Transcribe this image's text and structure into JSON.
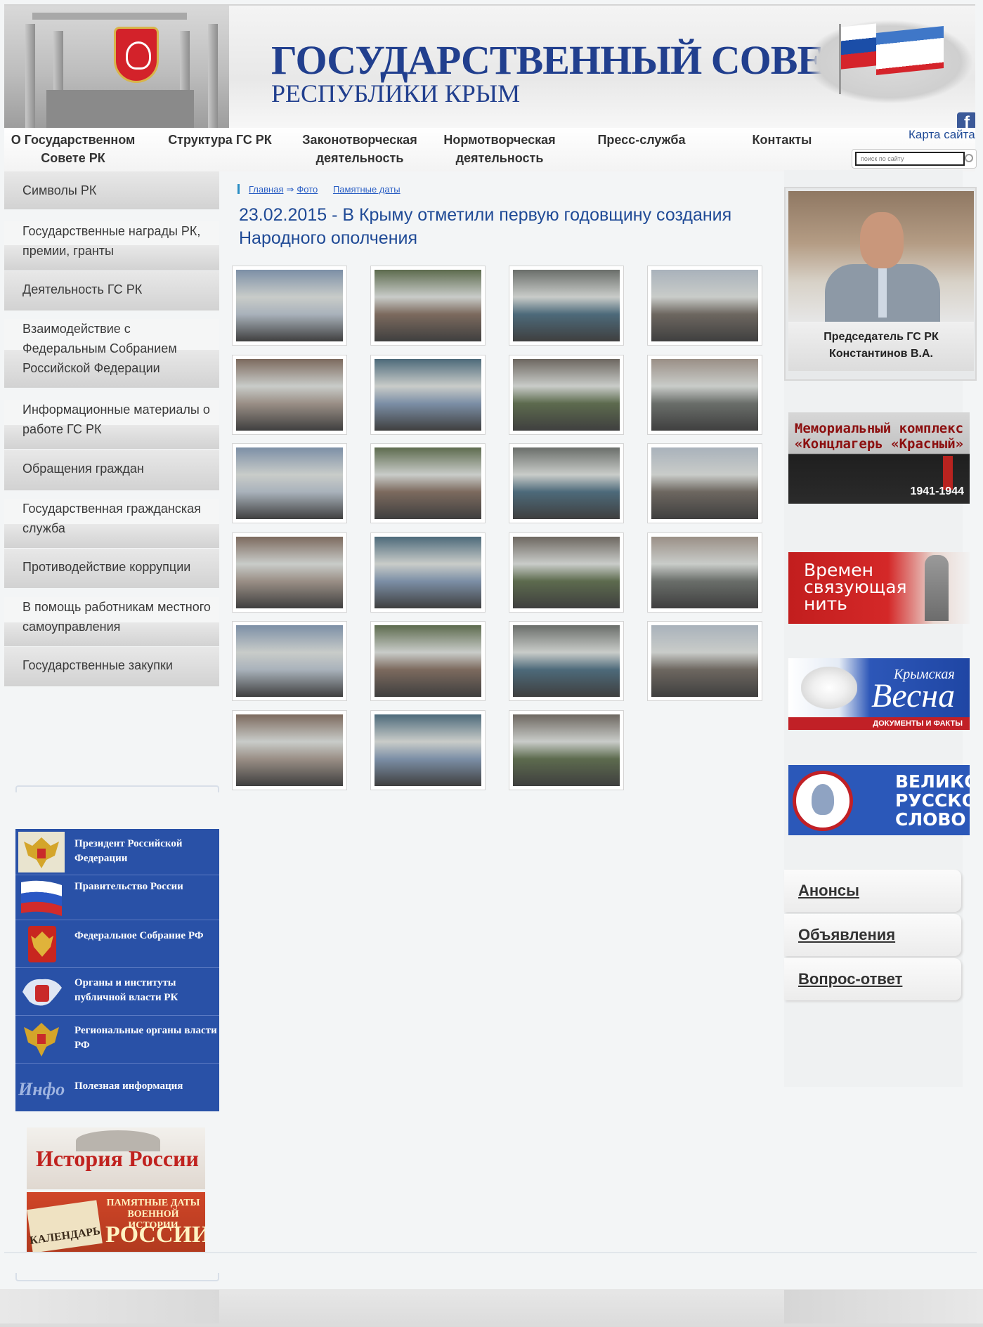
{
  "header": {
    "title_line1": "ГОСУДАРСТВЕННЫЙ СОВЕТ",
    "title_line2": "РЕСПУБЛИКИ КРЫМ",
    "facebook_icon": "facebook-icon"
  },
  "nav": {
    "items": [
      {
        "line1": "О Государственном",
        "line2": "Совете РК"
      },
      {
        "line1": "Структура ГС РК",
        "line2": ""
      },
      {
        "line1": "Законотворческая",
        "line2": "деятельность"
      },
      {
        "line1": "Нормотворческая",
        "line2": "деятельность"
      },
      {
        "line1": "Пресс-служба",
        "line2": ""
      },
      {
        "line1": "Контакты",
        "line2": ""
      }
    ],
    "sitemap_label": "Карта сайта",
    "search_placeholder": "поиск по сайту"
  },
  "left_menu": {
    "items": [
      "Символы РК",
      "Государственные награды РК, премии, гранты",
      "Деятельность ГС РК",
      "Взаимодействие с Федеральным Собранием Российской Федерации",
      "Информационные материалы о работе ГС РК",
      "Обращения граждан",
      "Государственная гражданская служба",
      "Противодействие коррупции",
      "В помощь работникам местного самоуправления",
      "Государственные закупки"
    ]
  },
  "links": {
    "items": [
      {
        "label": "Президент Российской Федерации",
        "icon": "russian-eagle-icon"
      },
      {
        "label": "Правительство России",
        "icon": "russian-flag-icon"
      },
      {
        "label": "Федеральное Собрание РФ",
        "icon": "federal-emblem-icon"
      },
      {
        "label": "Органы и институты публичной власти РК",
        "icon": "crimea-map-icon"
      },
      {
        "label": "Региональные органы власти РФ",
        "icon": "regional-eagle-icon"
      },
      {
        "label": "Полезная информация",
        "icon": "info-icon"
      }
    ],
    "info_icon_text": "Инфо"
  },
  "left_banners": {
    "history": "История России",
    "calendar_line1": "ПАМЯТНЫЕ ДАТЫ ВОЕННОЙ ИСТОРИИ",
    "calendar_line2": "РОССИИ",
    "calendar_tag": "КАЛЕНДАРЬ"
  },
  "breadcrumbs": {
    "home": "Главная",
    "photo": "Фото",
    "dates": "Памятные даты"
  },
  "article": {
    "title": "23.02.2015 - В Крыму отметили первую годовщину создания Народного ополчения"
  },
  "gallery": {
    "photo_count": 23,
    "palette": [
      "#7c8fa6",
      "#5d6b4e",
      "#6a6e6a",
      "#a9b2bb",
      "#7c6a5e",
      "#4d6a7a",
      "#6d6760",
      "#9a8f86"
    ]
  },
  "chairman": {
    "caption_line1": "Председатель ГС РК",
    "caption_line2": "Константинов В.А."
  },
  "right_banners": {
    "memorial_line1": "Мемориальный комплекс",
    "memorial_line2": "«Концлагерь «Красный»",
    "memorial_years": "1941-1944",
    "times_line1": "Времен",
    "times_line2": "связующая",
    "times_line3": "нить",
    "spring_small": "Крымская",
    "spring_big": "Весна",
    "spring_strip": "ДОКУМЕНТЫ И ФАКТЫ",
    "word_line1": "ВЕЛИКОЕ",
    "word_line2": "РУССКОЕ",
    "word_line3": "СЛОВО"
  },
  "right_tabs": [
    "Анонсы",
    "Объявления",
    "Вопрос-ответ"
  ]
}
